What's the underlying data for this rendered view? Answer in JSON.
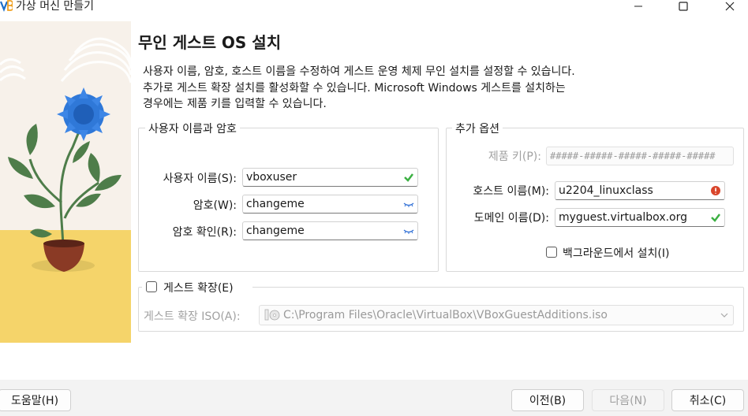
{
  "window": {
    "title": "가상 머신 만들기",
    "controls": [
      "minimize-icon",
      "maximize-icon",
      "close-icon"
    ]
  },
  "page": {
    "heading": "무인 게스트 OS 설치",
    "description": [
      "사용자 이름, 암호, 호스트 이름을 수정하여 게스트 운영 체제 무인 설치를 설정할 수 있습니다.",
      "추가로 게스트 확장 설치를 활성화할 수 있습니다. Microsoft Windows 게스트를 설치하는",
      "경우에는 제품 키를 입력할 수 있습니다."
    ]
  },
  "user_group": {
    "legend": "사용자 이름과 암호",
    "username": {
      "label": "사용자 이름(S):",
      "value": "vboxuser",
      "status_icon": "check-icon"
    },
    "password": {
      "label": "암호(W):",
      "value": "changeme",
      "status_icon": "eye-closed-icon"
    },
    "password_confirm": {
      "label": "암호 확인(R):",
      "value": "changeme",
      "status_icon": "eye-closed-icon"
    }
  },
  "options_group": {
    "legend": "추가 옵션",
    "product_key": {
      "label": "제품 키(P):",
      "placeholder": "#####-#####-#####-#####-#####"
    },
    "hostname": {
      "label": "호스트 이름(M):",
      "value": "u2204_linuxclass",
      "status_icon": "error-icon"
    },
    "domain": {
      "label": "도메인 이름(D):",
      "value": "myguest.virtualbox.org",
      "status_icon": "check-icon"
    },
    "background": {
      "label": "백그라운드에서 설치(I)",
      "checked": false
    }
  },
  "guest_additions": {
    "checkbox_label": "게스트 확장(E)",
    "checked": false,
    "iso_label": "게스트 확장 ISO(A):",
    "iso_path": "C:\\Program Files\\Oracle\\VirtualBox\\VBoxGuestAdditions.iso"
  },
  "buttons": {
    "help": "도움말(H)",
    "back": "이전(B)",
    "next": "다음(N)",
    "cancel": "취소(C)"
  },
  "colors": {
    "check": "#3cb043",
    "error": "#d9452b",
    "eye": "#2f6fd6",
    "flower": "#2f78d8",
    "leaf": "#4e7d4a",
    "pot": "#8a3a25",
    "ground": "#f5d46a"
  }
}
